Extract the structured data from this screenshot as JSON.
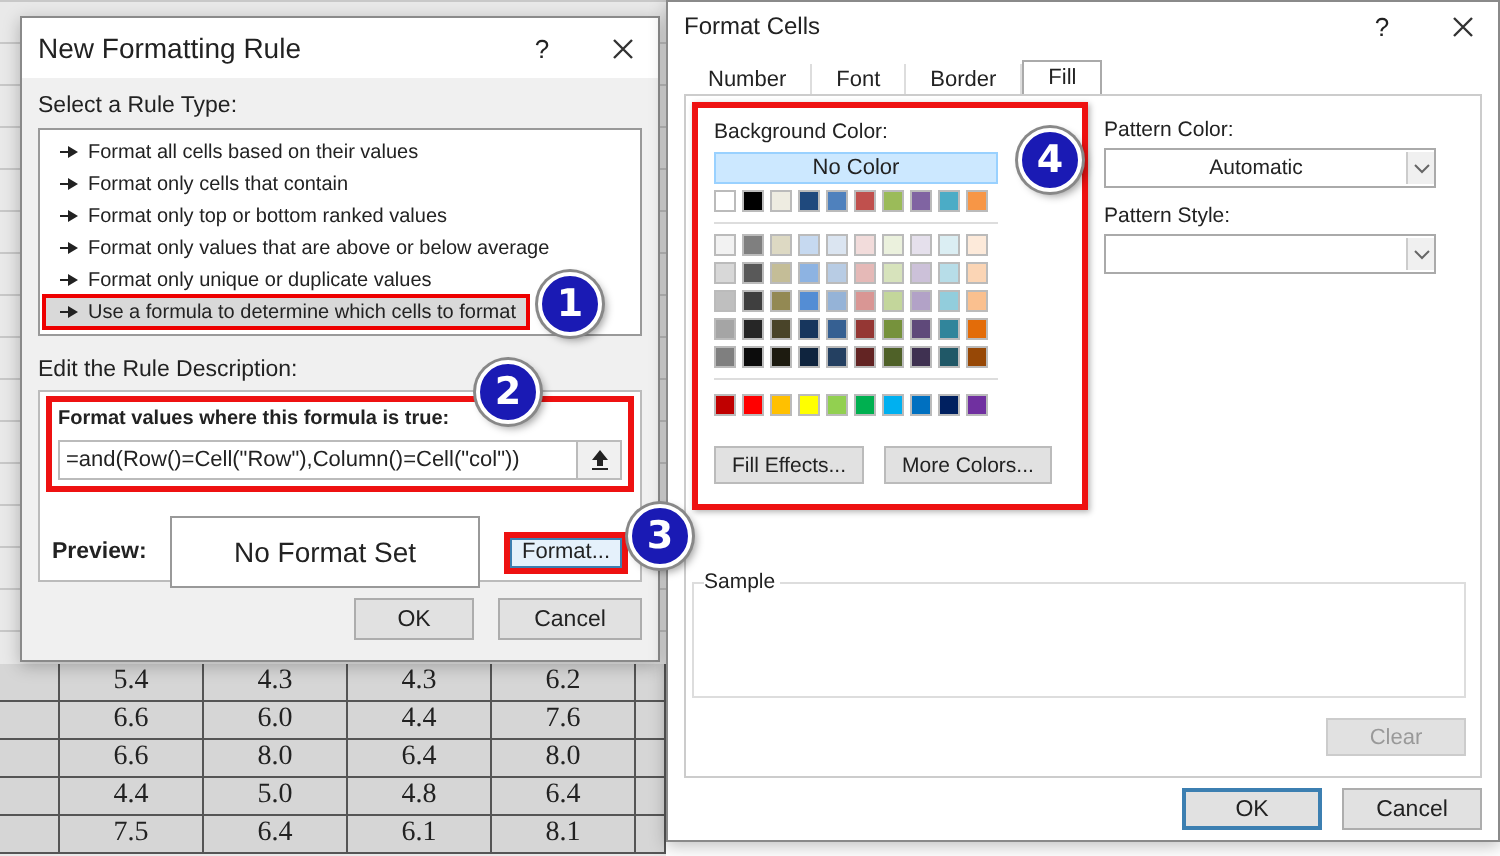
{
  "spreadsheet": {
    "rows": [
      {
        "cells": [
          "5.4",
          "4.3",
          "4.3",
          "6.2"
        ]
      },
      {
        "cells": [
          "6.6",
          "6.0",
          "4.4",
          "7.6"
        ]
      },
      {
        "cells": [
          "6.6",
          "8.0",
          "6.4",
          "8.0"
        ]
      },
      {
        "cells": [
          "4.4",
          "5.0",
          "4.8",
          "6.4"
        ]
      },
      {
        "cells": [
          "7.5",
          "6.4",
          "6.1",
          "8.1"
        ]
      }
    ]
  },
  "rule_dialog": {
    "title": "New Formatting Rule",
    "help": "?",
    "rule_type_label": "Select a Rule Type:",
    "rule_types": [
      {
        "label": "Format all cells based on their values",
        "selected": false,
        "highlighted": false
      },
      {
        "label": "Format only cells that contain",
        "selected": false,
        "highlighted": false
      },
      {
        "label": "Format only top or bottom ranked values",
        "selected": false,
        "highlighted": false
      },
      {
        "label": "Format only values that are above or below average",
        "selected": false,
        "highlighted": false
      },
      {
        "label": "Format only unique or duplicate values",
        "selected": false,
        "highlighted": false
      },
      {
        "label": "Use a formula to determine which cells to format",
        "selected": true,
        "highlighted": true
      }
    ],
    "description_label": "Edit the Rule Description:",
    "formula_section": {
      "label": "Format values where this formula is true:",
      "value": "=and(Row()=Cell(\"Row\"),Column()=Cell(\"col\"))",
      "highlighted": true
    },
    "preview": {
      "label": "Preview:",
      "text": "No Format Set"
    },
    "format_button": {
      "label": "Format...",
      "highlighted": true
    },
    "buttons": [
      "OK",
      "Cancel"
    ]
  },
  "format_cells": {
    "title": "Format Cells",
    "help": "?",
    "tabs": [
      {
        "label": "Number",
        "selected": false
      },
      {
        "label": "Font",
        "selected": false
      },
      {
        "label": "Border",
        "selected": false
      },
      {
        "label": "Fill",
        "selected": true
      }
    ],
    "fill_panel": {
      "highlighted": true,
      "label": "Background Color:",
      "no_color": {
        "label": "No Color",
        "selected": true
      },
      "theme_rows": [
        {
          "swatches": [
            {
              "color": "#ffffff"
            },
            {
              "color": "#000000"
            },
            {
              "color": "#eeece1"
            },
            {
              "color": "#1f497d"
            },
            {
              "color": "#4f81bd"
            },
            {
              "color": "#c0504d"
            },
            {
              "color": "#9bbb59"
            },
            {
              "color": "#8064a2"
            },
            {
              "color": "#4bacc6"
            },
            {
              "color": "#f79646"
            }
          ]
        },
        {
          "swatches": [
            {
              "color": "#f2f2f2"
            },
            {
              "color": "#7f7f7f"
            },
            {
              "color": "#ddd9c3"
            },
            {
              "color": "#c6d9f0"
            },
            {
              "color": "#dbe5f1"
            },
            {
              "color": "#f2dcdb"
            },
            {
              "color": "#ebf1dd"
            },
            {
              "color": "#e5e0ec"
            },
            {
              "color": "#dbeef3"
            },
            {
              "color": "#fdeada"
            }
          ]
        },
        {
          "swatches": [
            {
              "color": "#d8d8d8"
            },
            {
              "color": "#595959"
            },
            {
              "color": "#c4bd97"
            },
            {
              "color": "#8db3e2"
            },
            {
              "color": "#b8cce4"
            },
            {
              "color": "#e5b9b7"
            },
            {
              "color": "#d7e3bc"
            },
            {
              "color": "#ccc1d9"
            },
            {
              "color": "#b7dde8"
            },
            {
              "color": "#fbd5b5"
            }
          ]
        },
        {
          "swatches": [
            {
              "color": "#bfbfbf"
            },
            {
              "color": "#3f3f3f"
            },
            {
              "color": "#938953"
            },
            {
              "color": "#548dd4"
            },
            {
              "color": "#95b3d7"
            },
            {
              "color": "#d99694"
            },
            {
              "color": "#c3d69b"
            },
            {
              "color": "#b2a2c7"
            },
            {
              "color": "#92cddc"
            },
            {
              "color": "#fac08f"
            }
          ]
        },
        {
          "swatches": [
            {
              "color": "#a5a5a5"
            },
            {
              "color": "#262626"
            },
            {
              "color": "#494429"
            },
            {
              "color": "#17365d"
            },
            {
              "color": "#366092"
            },
            {
              "color": "#953734"
            },
            {
              "color": "#76923c"
            },
            {
              "color": "#5f497a"
            },
            {
              "color": "#31859b"
            },
            {
              "color": "#e36c09"
            }
          ]
        },
        {
          "swatches": [
            {
              "color": "#7f7f7f"
            },
            {
              "color": "#0c0c0c"
            },
            {
              "color": "#1d1b10"
            },
            {
              "color": "#0f243e"
            },
            {
              "color": "#244061"
            },
            {
              "color": "#632423"
            },
            {
              "color": "#4f6128"
            },
            {
              "color": "#3f3151"
            },
            {
              "color": "#205867"
            },
            {
              "color": "#974806"
            }
          ]
        }
      ],
      "standard_colors": [
        {
          "color": "#c00000"
        },
        {
          "color": "#ff0000"
        },
        {
          "color": "#ffc000"
        },
        {
          "color": "#ffff00"
        },
        {
          "color": "#92d050"
        },
        {
          "color": "#00b050"
        },
        {
          "color": "#00b0f0"
        },
        {
          "color": "#0070c0"
        },
        {
          "color": "#002060"
        },
        {
          "color": "#7030a0"
        }
      ],
      "buttons": [
        "Fill Effects...",
        "More Colors..."
      ]
    },
    "pattern_color": {
      "label": "Pattern Color:",
      "value": "Automatic"
    },
    "pattern_style": {
      "label": "Pattern Style:"
    },
    "sample": {
      "label": "Sample"
    },
    "clear_button": {
      "label": "Clear",
      "disabled": true
    },
    "buttons": [
      {
        "label": "OK",
        "focused": true
      },
      {
        "label": "Cancel",
        "focused": false
      }
    ]
  },
  "callouts": [
    {
      "number": "1"
    },
    {
      "number": "2"
    },
    {
      "number": "3"
    },
    {
      "number": "4"
    }
  ]
}
